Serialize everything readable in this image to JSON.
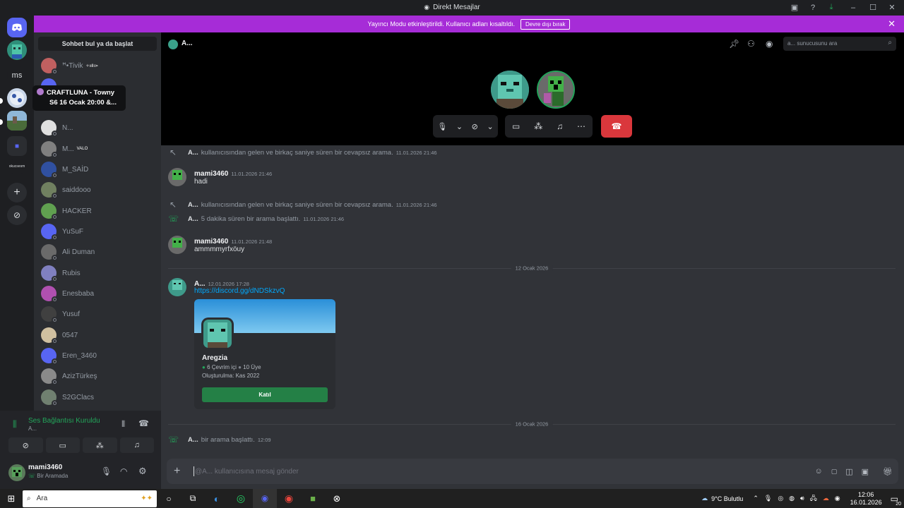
{
  "window": {
    "title": "Direkt Mesajlar"
  },
  "banner": {
    "text": "Yayıncı Modu etkinleştirildi. Kullanıcı adları kısaltıldı.",
    "button": "Devre dışı bırak"
  },
  "servers": {
    "ms_label": "ms",
    "small_label": "okucsesm"
  },
  "dm_panel": {
    "search": "Sohbet bul ya da başlat",
    "items": [
      {
        "name": "ꟸ•Tivik",
        "badge": "✧ııllı⋗"
      },
      {
        "name": "",
        "badge": ""
      },
      {
        "name": "N...",
        "badge": ""
      },
      {
        "name": "M...",
        "badge": "VALO"
      },
      {
        "name": "M_SAİD",
        "badge": ""
      },
      {
        "name": "saiddooo",
        "badge": ""
      },
      {
        "name": "HACKER",
        "badge": ""
      },
      {
        "name": "YuSuF",
        "badge": ""
      },
      {
        "name": "Ali Duman",
        "badge": ""
      },
      {
        "name": "Rubis",
        "badge": ""
      },
      {
        "name": "Enesbaba",
        "badge": ""
      },
      {
        "name": "Yusuf",
        "badge": ""
      },
      {
        "name": "0547",
        "badge": ""
      },
      {
        "name": "Eren_3460",
        "badge": ""
      },
      {
        "name": "AzizTürkeş",
        "badge": ""
      },
      {
        "name": "S2GClacs",
        "badge": ""
      }
    ]
  },
  "tooltip": {
    "line1": "CRAFTLUNA - Towny",
    "line2": "S6 16 Ocak 20:00 &..."
  },
  "voice": {
    "status": "Ses Bağlantısı Kuruldu",
    "channel": "A..."
  },
  "user": {
    "name": "mami3460",
    "status": "Bir Aramada"
  },
  "chat_header": {
    "name": "A...",
    "search_placeholder": "a... sunucusunu ara"
  },
  "messages": {
    "m1": {
      "user": "A...",
      "text": "kullanıcısından gelen ve birkaç saniye süren bir cevapsız arama.",
      "time": "11.01.2026 21:46"
    },
    "m2": {
      "user": "mami3460",
      "time": "11.01.2026 21:46",
      "text": "hadi"
    },
    "m3": {
      "user": "A...",
      "text": "kullanıcısından gelen ve birkaç saniye süren bir cevapsız arama.",
      "time": "11.01.2026 21:46"
    },
    "m4": {
      "user": "A...",
      "text": "5 dakika süren bir arama başlattı.",
      "time": "11.01.2026 21:46"
    },
    "m5": {
      "user": "mami3460",
      "time": "11.01.2026 21:48",
      "text": "ammmmyrfxöuy"
    },
    "d1": "12 Ocak 2026",
    "m6": {
      "user": "A...",
      "time": "12.01.2026 17:28",
      "link": "https://discord.gg/dNDSkzvQ"
    },
    "d2": "16 Ocak 2026",
    "m7": {
      "user": "A...",
      "text": "bir arama başlattı.",
      "time": "12:09"
    }
  },
  "invite": {
    "server": "Aregzia",
    "online": "6 Çevrim içi",
    "members": "10 Üye",
    "created": "Oluşturulma: Kas 2022",
    "join": "Katıl"
  },
  "composer": {
    "placeholder": "@A... kullanıcısına mesaj gönder"
  },
  "taskbar": {
    "search": "Ara",
    "weather_temp": "9°C",
    "weather_text": "Bulutlu",
    "time": "12:06",
    "date": "16.01.2026",
    "notif": "20"
  },
  "colors": {
    "accent": "#5865f2",
    "banner": "#a62cd7",
    "green": "#23a55a",
    "hangup": "#da373c",
    "link": "#00a8fc"
  }
}
